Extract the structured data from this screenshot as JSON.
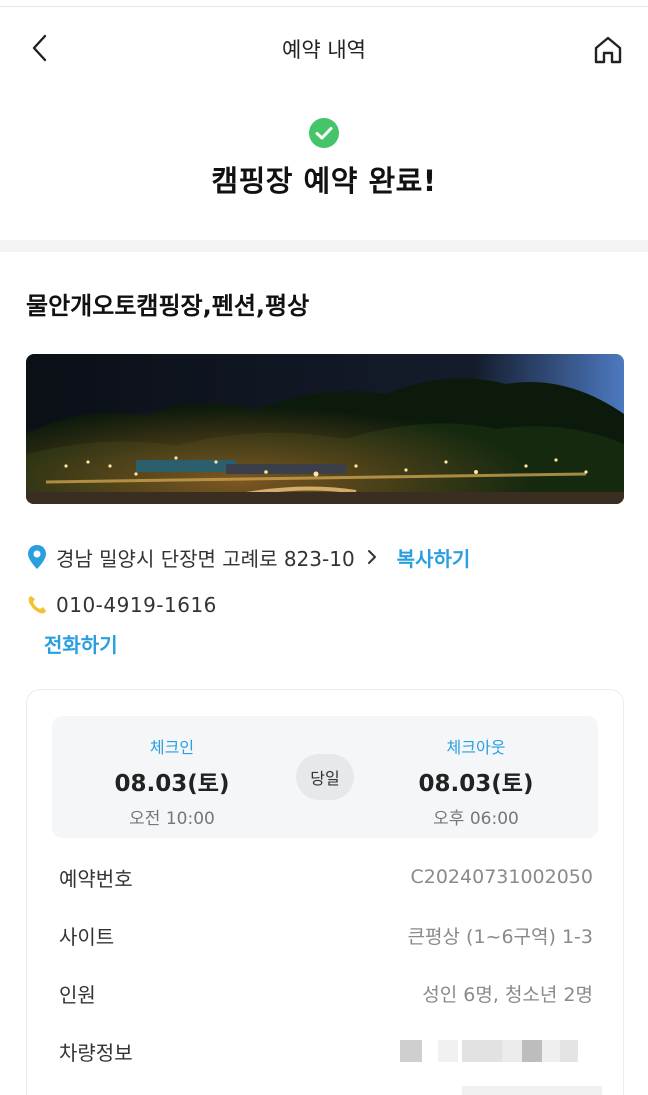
{
  "header": {
    "title": "예약 내역"
  },
  "completion": {
    "title": "캠핑장 예약 완료!"
  },
  "campsite": {
    "name": "물안개오토캠핑장,펜션,평상",
    "address": "경남 밀양시 단장면 고례로 823-10",
    "copy_label": "복사하기",
    "phone": "010-4919-1616",
    "call_label": "전화하기"
  },
  "stay": {
    "checkin_label": "체크인",
    "checkin_date": "08.03(토)",
    "checkin_time": "오전 10:00",
    "sameday_label": "당일",
    "checkout_label": "체크아웃",
    "checkout_date": "08.03(토)",
    "checkout_time": "오후 06:00"
  },
  "details": [
    {
      "key": "예약번호",
      "value": "C20240731002050"
    },
    {
      "key": "사이트",
      "value": "큰평상 (1~6구역) 1-3"
    },
    {
      "key": "인원",
      "value": "성인 6명, 청소년 2명"
    },
    {
      "key": "차량정보",
      "value": ""
    }
  ],
  "colors": {
    "accent": "#2a9fe0",
    "success": "#45c46a",
    "phone_icon": "#f2c230"
  },
  "icons": {
    "back": "chevron-left-icon",
    "home": "home-icon",
    "check": "check-circle-icon",
    "pin": "location-pin-icon",
    "phone": "phone-icon"
  }
}
